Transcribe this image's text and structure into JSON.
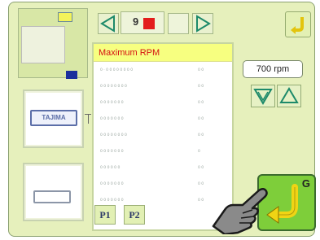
{
  "header": {
    "pattern_number": "9"
  },
  "panel": {
    "title": "Maximum RPM",
    "items": [
      {
        "label": "0 · 0 0 0 0 0 0 0 0",
        "sub": "(0 0 0 0 0 0 0 0 0 0)",
        "value": "0 0"
      },
      {
        "label": "0 0 0 0 0 0 0 0",
        "sub": "(0 0 0 0 0 0)",
        "value": "0 0"
      },
      {
        "label": "0 0 0 0 0 0 0",
        "sub": "(0 0 0 0 0)",
        "value": "0 0"
      },
      {
        "label": "0 0 0 0 0 0 0",
        "sub": "(0 0 0 0 0)",
        "value": "0 0"
      },
      {
        "label": "0 0 0 0 0 0 0 0",
        "sub": "(0 0 0 0 0 0 0 0)",
        "value": "0 0"
      },
      {
        "label": "0 0 0 0 0 0 0",
        "sub": "(0 0 0 0 0)",
        "value": "0"
      },
      {
        "label": "0 0 0 0 0 0",
        "sub": "(0 0 0 0 0)",
        "value": "0 0"
      },
      {
        "label": "0 0 0 0 0 0 0",
        "sub": "(0 0 0 0 0)",
        "value": "0 0"
      },
      {
        "label": "0 0 0 0 0 0 0",
        "sub": "(0 0 0 0 0)",
        "value": "0 0"
      }
    ],
    "tabs": [
      "P1",
      "P2"
    ]
  },
  "speed": {
    "value": "700 rpm"
  },
  "thumbnails": {
    "logo_text": "TAJIMA"
  },
  "enter_button": {
    "letter": "G"
  },
  "colors": {
    "background": "#e6f0bc",
    "header_bar": "#f7ff80",
    "header_text": "#d51010",
    "enter_green": "#7ece3a",
    "accent_red": "#e31c1c",
    "chip_yellow": "#f3f35a",
    "chip_blue": "#1b2f9c"
  },
  "icons": [
    "left-arrow-icon",
    "right-arrow-icon",
    "down-arrow-icon",
    "up-arrow-icon",
    "return-icon",
    "hand-pointer-icon"
  ]
}
